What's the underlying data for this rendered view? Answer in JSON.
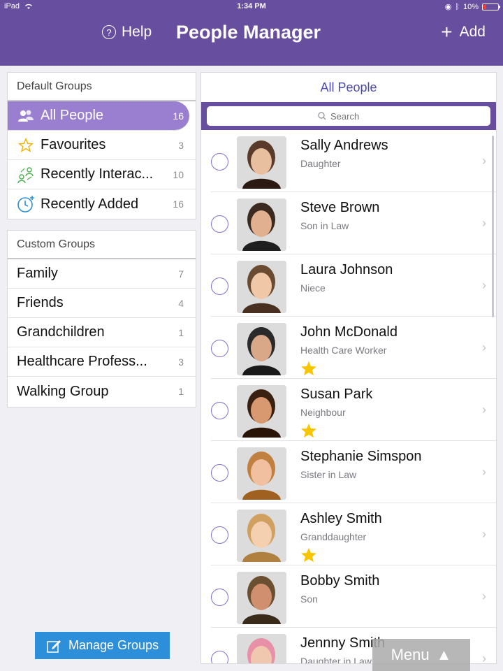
{
  "status_bar": {
    "device": "iPad",
    "time": "1:34 PM",
    "battery": "10%"
  },
  "nav": {
    "help_label": "Help",
    "title": "People Manager",
    "add_label": "Add"
  },
  "default_groups": {
    "header": "Default Groups",
    "items": [
      {
        "label": "All People",
        "count": "16",
        "icon": "people-icon",
        "selected": true
      },
      {
        "label": "Favourites",
        "count": "3",
        "icon": "star-outline-icon"
      },
      {
        "label": "Recently Interac...",
        "count": "10",
        "icon": "interaction-icon"
      },
      {
        "label": "Recently Added",
        "count": "16",
        "icon": "clock-plus-icon"
      }
    ]
  },
  "custom_groups": {
    "header": "Custom Groups",
    "items": [
      {
        "label": "Family",
        "count": "7"
      },
      {
        "label": "Friends",
        "count": "4"
      },
      {
        "label": "Grandchildren",
        "count": "1"
      },
      {
        "label": "Healthcare Profess...",
        "count": "3"
      },
      {
        "label": "Walking Group",
        "count": "1"
      }
    ]
  },
  "manage_groups_label": "Manage Groups",
  "people_panel": {
    "title": "All People",
    "search_placeholder": "Search",
    "people": [
      {
        "name": "Sally Andrews",
        "relation": "Daughter",
        "favourite": false
      },
      {
        "name": "Steve Brown",
        "relation": "Son in Law",
        "favourite": false
      },
      {
        "name": "Laura Johnson",
        "relation": "Niece",
        "favourite": false
      },
      {
        "name": "John McDonald",
        "relation": "Health Care Worker",
        "favourite": true
      },
      {
        "name": "Susan Park",
        "relation": "Neighbour",
        "favourite": true
      },
      {
        "name": "Stephanie Simspon",
        "relation": "Sister in Law",
        "favourite": false
      },
      {
        "name": "Ashley Smith",
        "relation": "Granddaughter",
        "favourite": true
      },
      {
        "name": "Bobby Smith",
        "relation": "Son",
        "favourite": false
      },
      {
        "name": "Jennny Smith",
        "relation": "Daughter in Law",
        "favourite": false
      }
    ]
  },
  "menu_label": "Menu",
  "colors": {
    "header_purple": "#674e9e",
    "selected_row": "#9a7fd1",
    "accent_blue": "#2d8fda",
    "star": "#f7c600"
  }
}
